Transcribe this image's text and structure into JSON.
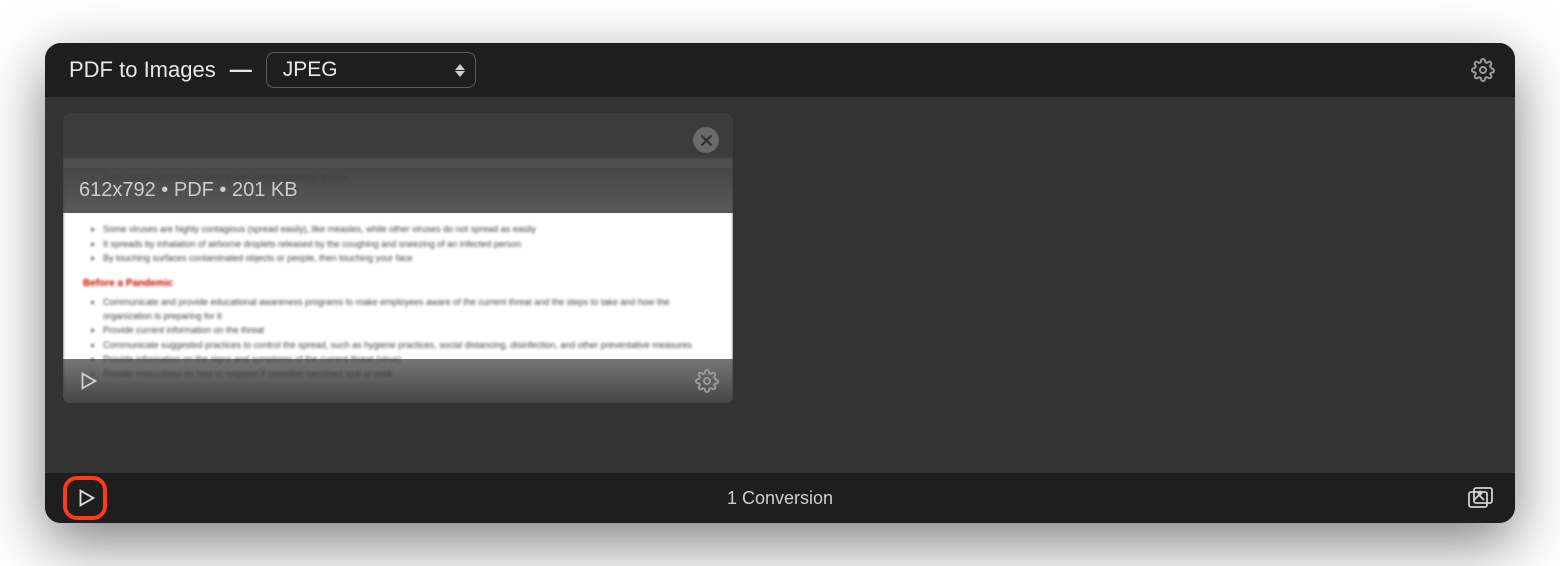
{
  "header": {
    "title": "PDF to Images",
    "separator": "—",
    "format_selected": "JPEG"
  },
  "file": {
    "dimensions": "612x792",
    "type": "PDF",
    "size": "201 KB",
    "metadata_separator": " • "
  },
  "footer": {
    "status_count": "1",
    "status_label": "Conversion"
  },
  "colors": {
    "highlight": "#ff3b1a",
    "background_dark": "#1e1e1e",
    "background_mid": "#333333"
  },
  "icons": {
    "gear": "gear-icon",
    "close": "close-icon",
    "play": "play-icon",
    "chevrons": "select-chevrons-icon",
    "images": "images-icon"
  }
}
